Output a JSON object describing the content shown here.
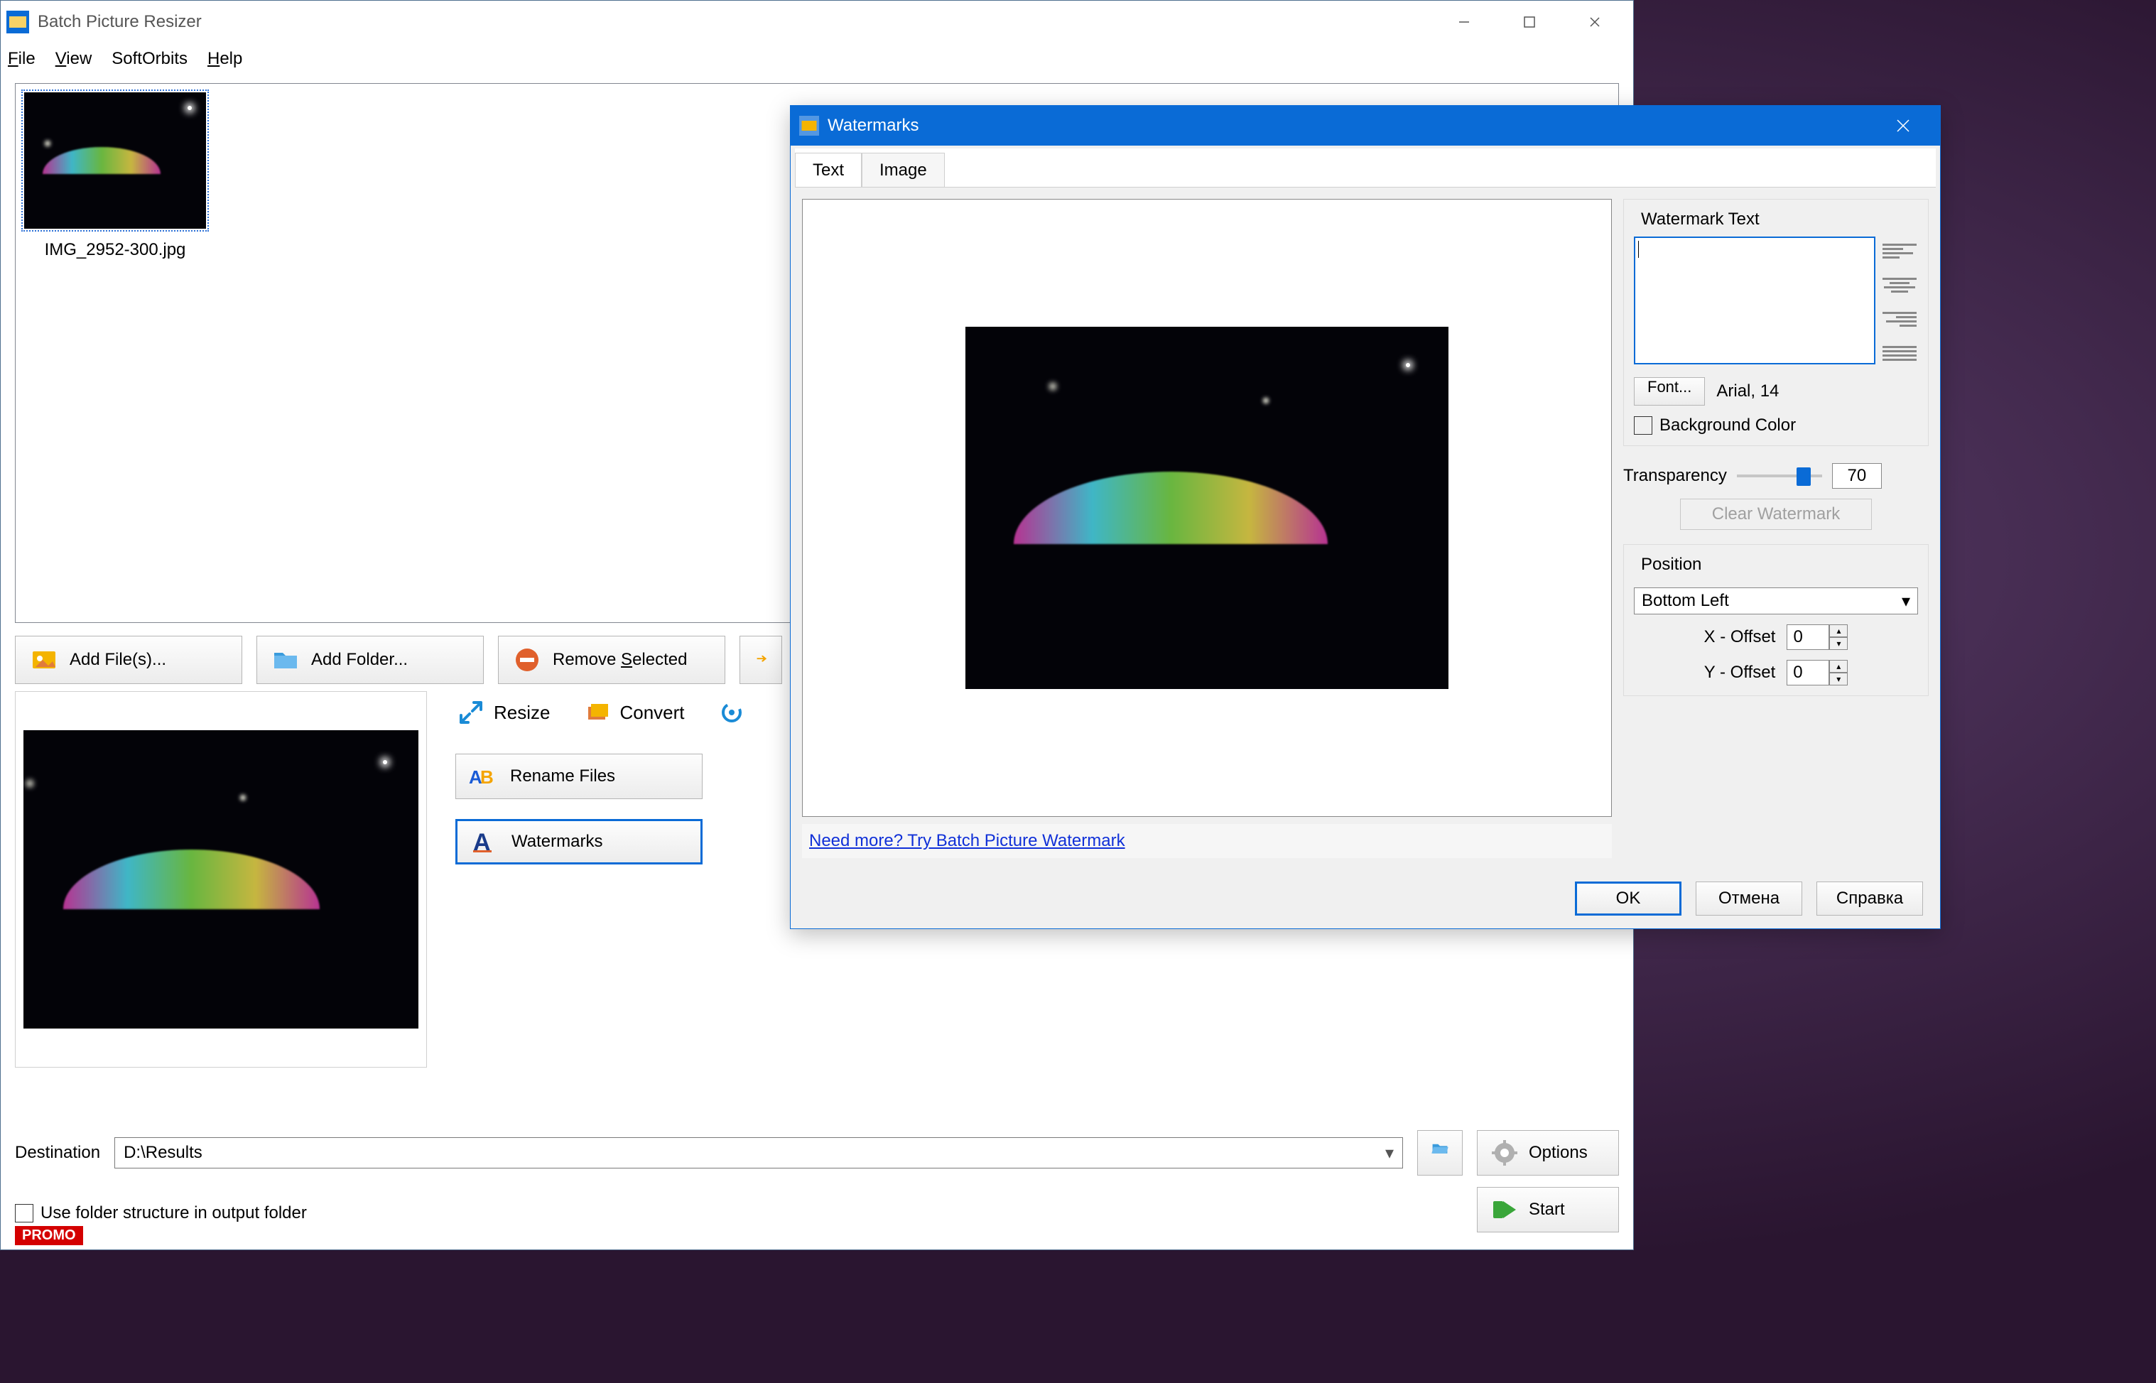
{
  "main": {
    "title": "Batch Picture Resizer",
    "menus": {
      "file": "File",
      "view": "View",
      "softorbits": "SoftOrbits",
      "help": "Help"
    },
    "thumb": {
      "filename": "IMG_2952-300.jpg"
    },
    "toolbar": {
      "add_files": "Add File(s)...",
      "add_folder": "Add Folder...",
      "remove_selected": "Remove Selected"
    },
    "tabs": {
      "resize": "Resize",
      "convert": "Convert"
    },
    "actions": {
      "rename": "Rename Files",
      "watermarks": "Watermarks"
    },
    "destination_label": "Destination",
    "destination_value": "D:\\Results",
    "use_folder_structure": "Use folder structure in output folder",
    "options": "Options",
    "start": "Start",
    "promo": "PROMO"
  },
  "dialog": {
    "title": "Watermarks",
    "tabs": {
      "text": "Text",
      "image": "Image"
    },
    "link": "Need more? Try Batch Picture Watermark",
    "group_watermark_text": "Watermark Text",
    "watermark_text_value": "",
    "font_btn": "Font...",
    "font_display": "Arial, 14",
    "background_color": "Background Color",
    "transparency_label": "Transparency",
    "transparency_value": "70",
    "clear_watermark": "Clear Watermark",
    "position_group": "Position",
    "position_value": "Bottom Left",
    "x_offset_label": "X - Offset",
    "x_offset_value": "0",
    "y_offset_label": "Y - Offset",
    "y_offset_value": "0",
    "buttons": {
      "ok": "OK",
      "cancel": "Отмена",
      "help": "Справка"
    }
  }
}
